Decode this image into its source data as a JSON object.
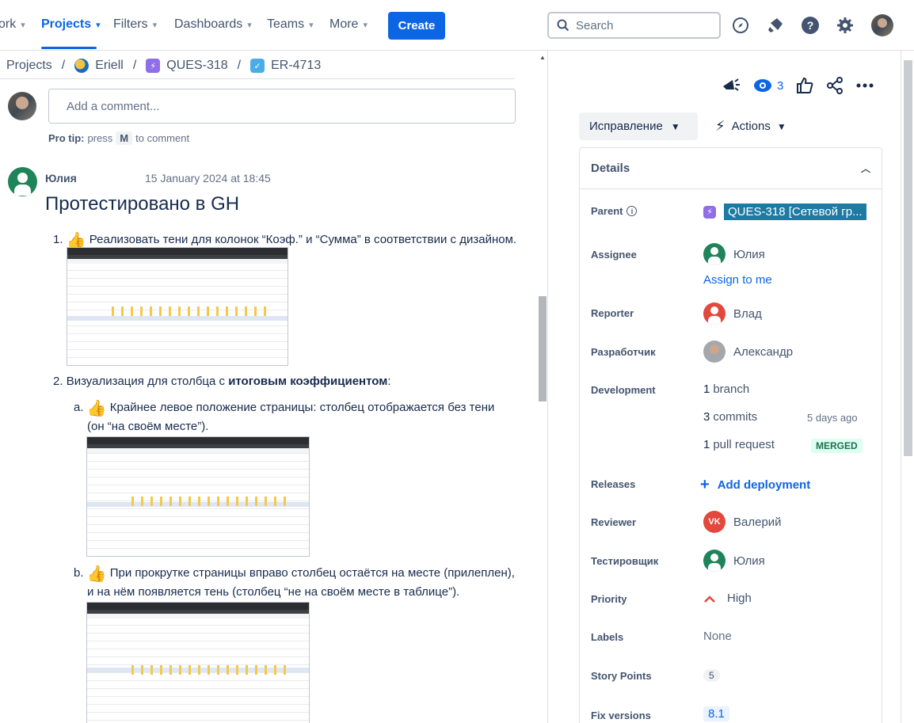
{
  "nav": {
    "items": [
      "ork",
      "Projects",
      "Filters",
      "Dashboards",
      "Teams",
      "More"
    ],
    "create_label": "Create",
    "search_placeholder": "Search"
  },
  "breadcrumb": [
    "Projects",
    "Eriell",
    "QUES-318",
    "ER-4713"
  ],
  "comment_box": {
    "placeholder": "Add a comment...",
    "protip_prefix": "Pro tip:",
    "protip_press": "press",
    "protip_key": "M",
    "protip_suffix": "to comment"
  },
  "comment": {
    "author": "Юлия",
    "date": "15 January 2024 at 18:45",
    "heading": "Протестировано в GH",
    "item1": "Реализовать тени для колонок “Коэф.” и “Сумма” в соответствии с дизайном.",
    "item2_prefix": "Визуализация для столбца с ",
    "item2_bold": "итоговым коэффициентом",
    "item2_suffix": ":",
    "item2a_line1": "Крайнее левое положение страницы: столбец отображается без тени",
    "item2a_line2": "(он “на своём месте”).",
    "item2b_line1": "При прокрутке страницы вправо столбец остаётся на месте (прилеплен),",
    "item2b_line2": "и на нём появляется тень (столбец “не на своём месте в таблице”).",
    "num1": "1.",
    "num2": "2.",
    "let_a": "a.",
    "let_b": "b."
  },
  "issue": {
    "watch_count": "3",
    "status": "Исправление",
    "actions": "Actions",
    "details_title": "Details",
    "fields": {
      "parent_label": "Parent",
      "parent_value": "QUES-318 [Сетевой гр...",
      "assignee_label": "Assignee",
      "assignee_value": "Юлия",
      "assign_to_me": "Assign to me",
      "reporter_label": "Reporter",
      "reporter_value": "Влад",
      "developer_label": "Разработчик",
      "developer_value": "Александр",
      "development_label": "Development",
      "dev_branch_num": "1",
      "dev_branch": "branch",
      "dev_commits_num": "3",
      "dev_commits": "commits",
      "dev_commits_time": "5 days ago",
      "dev_pr_num": "1",
      "dev_pr": "pull request",
      "dev_pr_status": "MERGED",
      "releases_label": "Releases",
      "releases_value": "Add deployment",
      "reviewer_label": "Reviewer",
      "reviewer_initials": "VK",
      "reviewer_value": "Валерий",
      "tester_label": "Тестировщик",
      "tester_value": "Юлия",
      "priority_label": "Priority",
      "priority_value": "High",
      "labels_label": "Labels",
      "labels_value": "None",
      "story_points_label": "Story Points",
      "story_points_value": "5",
      "fix_versions_label": "Fix versions",
      "fix_versions_value": "8.1"
    }
  },
  "colors": {
    "accent": "#0c66e4",
    "green_avatar": "#1f845a",
    "red_avatar": "#e2483d",
    "merged_bg": "#dcfff1",
    "parent_chip": "#1d7aa3"
  }
}
